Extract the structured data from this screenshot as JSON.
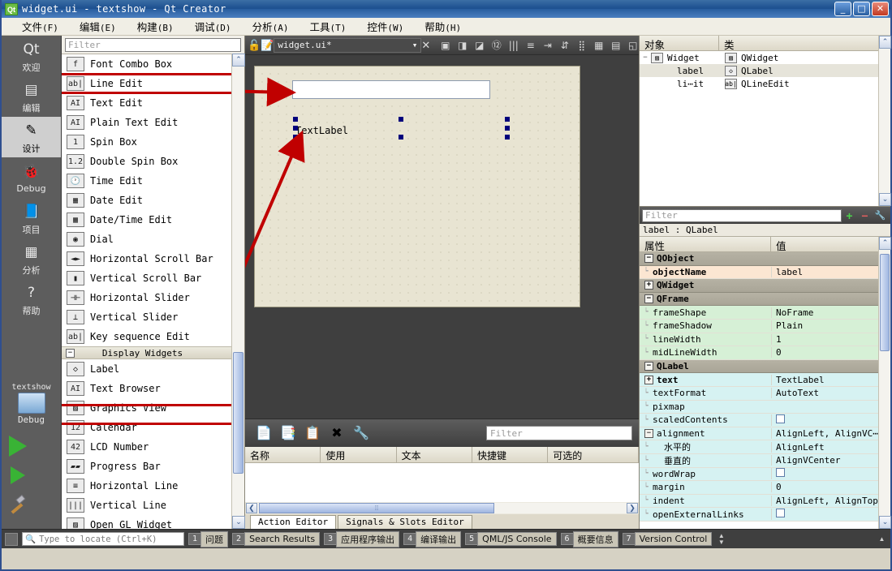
{
  "window": {
    "title": "widget.ui - textshow - Qt Creator",
    "app_icon": "qt-logo-icon",
    "minimize": "_",
    "maximize": "□",
    "close": "✕"
  },
  "menubar": [
    {
      "label": "文件",
      "mnemonic": "(F)"
    },
    {
      "label": "编辑",
      "mnemonic": "(E)"
    },
    {
      "label": "构建",
      "mnemonic": "(B)"
    },
    {
      "label": "调试",
      "mnemonic": "(D)"
    },
    {
      "label": "分析",
      "mnemonic": "(A)"
    },
    {
      "label": "工具",
      "mnemonic": "(T)"
    },
    {
      "label": "控件",
      "mnemonic": "(W)"
    },
    {
      "label": "帮助",
      "mnemonic": "(H)"
    }
  ],
  "modebar": {
    "items": [
      {
        "label": "欢迎",
        "icon": "qt-welcome-icon",
        "glyph": "Qt",
        "selected": false
      },
      {
        "label": "编辑",
        "icon": "edit-document-icon",
        "glyph": "▤",
        "selected": false
      },
      {
        "label": "设计",
        "icon": "design-brush-icon",
        "glyph": "✎",
        "selected": true
      },
      {
        "label": "Debug",
        "icon": "debug-bug-icon",
        "glyph": "🐞",
        "selected": false
      },
      {
        "label": "项目",
        "icon": "projects-folder-icon",
        "glyph": "📘",
        "selected": false
      },
      {
        "label": "分析",
        "icon": "analyze-monitor-icon",
        "glyph": "▦",
        "selected": false
      },
      {
        "label": "帮助",
        "icon": "help-question-icon",
        "glyph": "?",
        "selected": false
      }
    ],
    "kit": {
      "project": "textshow",
      "build_config": "Debug",
      "icon": "target-computer-icon",
      "arrow": "▸"
    },
    "run_button": "run-icon",
    "debug_button": "debug-run-icon",
    "build_button": "build-hammer-icon"
  },
  "widgetbox": {
    "filter_placeholder": "Filter",
    "items": [
      {
        "label": "Font Combo Box",
        "icon": "font-combo-box-icon",
        "glyph": "f"
      },
      {
        "label": "Line Edit",
        "icon": "line-edit-icon",
        "glyph": "ab|",
        "highlighted": true
      },
      {
        "label": "Text Edit",
        "icon": "text-edit-icon",
        "glyph": "AI"
      },
      {
        "label": "Plain Text Edit",
        "icon": "plain-text-edit-icon",
        "glyph": "AI"
      },
      {
        "label": "Spin Box",
        "icon": "spin-box-icon",
        "glyph": "1"
      },
      {
        "label": "Double Spin Box",
        "icon": "double-spin-box-icon",
        "glyph": "1.2"
      },
      {
        "label": "Time Edit",
        "icon": "time-edit-icon",
        "glyph": "🕐"
      },
      {
        "label": "Date Edit",
        "icon": "date-edit-icon",
        "glyph": "▦"
      },
      {
        "label": "Date/Time Edit",
        "icon": "date-time-edit-icon",
        "glyph": "▦"
      },
      {
        "label": "Dial",
        "icon": "dial-icon",
        "glyph": "◉"
      },
      {
        "label": "Horizontal Scroll Bar",
        "icon": "horizontal-scroll-bar-icon",
        "glyph": "◄►"
      },
      {
        "label": "Vertical Scroll Bar",
        "icon": "vertical-scroll-bar-icon",
        "glyph": "▮"
      },
      {
        "label": "Horizontal Slider",
        "icon": "horizontal-slider-icon",
        "glyph": "⊣⊢"
      },
      {
        "label": "Vertical Slider",
        "icon": "vertical-slider-icon",
        "glyph": "⊥"
      },
      {
        "label": "Key sequence Edit",
        "icon": "key-sequence-edit-icon",
        "glyph": "ab|"
      }
    ],
    "group": {
      "label": "Display Widgets",
      "expander": "−"
    },
    "display_items": [
      {
        "label": "Label",
        "icon": "label-tag-icon",
        "glyph": "◇",
        "highlighted": true
      },
      {
        "label": "Text Browser",
        "icon": "text-browser-icon",
        "glyph": "AI"
      },
      {
        "label": "Graphics View",
        "icon": "graphics-view-icon",
        "glyph": "▨"
      },
      {
        "label": "Calendar",
        "icon": "calendar-icon",
        "glyph": "12"
      },
      {
        "label": "LCD Number",
        "icon": "lcd-number-icon",
        "glyph": "42"
      },
      {
        "label": "Progress Bar",
        "icon": "progress-bar-icon",
        "glyph": "▰▰"
      },
      {
        "label": "Horizontal Line",
        "icon": "horizontal-line-icon",
        "glyph": "≡"
      },
      {
        "label": "Vertical Line",
        "icon": "vertical-line-icon",
        "glyph": "|||"
      },
      {
        "label": "Open GL Widget",
        "icon": "opengl-widget-icon",
        "glyph": "▨"
      }
    ],
    "scroll_up": "⌃",
    "scroll_down": "⌄"
  },
  "doctoolbar": {
    "lock_icon": "lock-icon",
    "file_icon": "ui-file-icon",
    "document": "widget.ui*",
    "dropdown": "▾",
    "close": "✕",
    "tools": [
      {
        "icon": "edit-widgets-icon",
        "glyph": "▣"
      },
      {
        "icon": "edit-signals-slots-icon",
        "glyph": "◨"
      },
      {
        "icon": "edit-buddies-icon",
        "glyph": "◪"
      },
      {
        "icon": "edit-tab-order-icon",
        "glyph": "⑫"
      },
      {
        "icon": "layout-horizontally-icon",
        "glyph": "|||"
      },
      {
        "icon": "layout-vertically-icon",
        "glyph": "≡"
      },
      {
        "icon": "layout-splitter-h-icon",
        "glyph": "⇥"
      },
      {
        "icon": "layout-splitter-v-icon",
        "glyph": "⇵"
      },
      {
        "icon": "layout-form-icon",
        "glyph": "⣿"
      },
      {
        "icon": "layout-grid-icon",
        "glyph": "▦"
      },
      {
        "icon": "break-layout-icon",
        "glyph": "▤"
      },
      {
        "icon": "adjust-size-icon",
        "glyph": "◱"
      }
    ]
  },
  "canvas": {
    "form_name": "Widget",
    "line_edit": {
      "name": "lineEdit",
      "text": ""
    },
    "label": {
      "name": "label",
      "text": "TextLabel",
      "selected": true
    },
    "annotations": [
      {
        "name": "arrow-to-line-edit",
        "from": "Line Edit",
        "to": "lineEdit on form"
      },
      {
        "name": "arrow-to-label",
        "from": "Label",
        "to": "TextLabel on form"
      }
    ]
  },
  "actioneditor": {
    "tools": [
      {
        "icon": "new-action-icon",
        "glyph": "📄"
      },
      {
        "icon": "copy-action-icon",
        "glyph": "📑"
      },
      {
        "icon": "paste-action-icon",
        "glyph": "📋"
      },
      {
        "icon": "delete-action-icon",
        "glyph": "✖"
      },
      {
        "icon": "configure-icon",
        "glyph": "🔧"
      }
    ],
    "filter_placeholder": "Filter",
    "columns": [
      "名称",
      "使用",
      "文本",
      "快捷键",
      "可选的"
    ],
    "rows": [],
    "tabs": [
      {
        "label": "Action Editor",
        "selected": true
      },
      {
        "label": "Signals & Slots Editor",
        "selected": false
      }
    ],
    "scroll_left": "❮",
    "scroll_right": "❯"
  },
  "objectinspector": {
    "columns": [
      "对象",
      "类"
    ],
    "rows": [
      {
        "indent": 0,
        "twisty": "−",
        "name": "Widget",
        "class": "QWidget",
        "icon": "qwidget-icon",
        "glyph": "▨",
        "selected": false
      },
      {
        "indent": 1,
        "twisty": "",
        "name": "label",
        "class": "QLabel",
        "icon": "qlabel-icon",
        "glyph": "◇",
        "selected": true
      },
      {
        "indent": 1,
        "twisty": "",
        "name": "li⋯it",
        "class": "QLineEdit",
        "icon": "qlineedit-icon",
        "glyph": "ab|",
        "selected": false
      }
    ],
    "scroll_up": "⌃",
    "scroll_down": "⌄"
  },
  "propertyeditor": {
    "filter_placeholder": "Filter",
    "add_button": "+",
    "remove_button": "−",
    "configure_button": "🔧",
    "subject": "label : QLabel",
    "columns": [
      "属性",
      "值"
    ],
    "rows": [
      {
        "kind": "group",
        "expander": "−",
        "name": "QObject",
        "value": "",
        "tint": "group"
      },
      {
        "kind": "prop",
        "name": "objectName",
        "value": "label",
        "tint": "peach",
        "bold": true
      },
      {
        "kind": "group",
        "expander": "+",
        "name": "QWidget",
        "value": "",
        "tint": "group"
      },
      {
        "kind": "group",
        "expander": "−",
        "name": "QFrame",
        "value": "",
        "tint": "group"
      },
      {
        "kind": "prop",
        "name": "frameShape",
        "value": "NoFrame",
        "tint": "green"
      },
      {
        "kind": "prop",
        "name": "frameShadow",
        "value": "Plain",
        "tint": "green"
      },
      {
        "kind": "prop",
        "name": "lineWidth",
        "value": "1",
        "tint": "green"
      },
      {
        "kind": "prop",
        "name": "midLineWidth",
        "value": "0",
        "tint": "green"
      },
      {
        "kind": "group",
        "expander": "−",
        "name": "QLabel",
        "value": "",
        "tint": "group"
      },
      {
        "kind": "prop",
        "expander": "+",
        "name": "text",
        "value": "TextLabel",
        "tint": "cyan",
        "bold": true
      },
      {
        "kind": "prop",
        "name": "textFormat",
        "value": "AutoText",
        "tint": "cyan"
      },
      {
        "kind": "prop",
        "name": "pixmap",
        "value": "",
        "tint": "cyan"
      },
      {
        "kind": "prop",
        "name": "scaledContents",
        "value": "",
        "tint": "cyan",
        "checkbox": true
      },
      {
        "kind": "prop",
        "expander": "−",
        "name": "alignment",
        "value": "AlignLeft, AlignVC⋯",
        "tint": "cyan"
      },
      {
        "kind": "sub",
        "name": "水平的",
        "value": "AlignLeft",
        "tint": "cyan"
      },
      {
        "kind": "sub",
        "name": "垂直的",
        "value": "AlignVCenter",
        "tint": "cyan"
      },
      {
        "kind": "prop",
        "name": "wordWrap",
        "value": "",
        "tint": "cyan",
        "checkbox": true
      },
      {
        "kind": "prop",
        "name": "margin",
        "value": "0",
        "tint": "cyan"
      },
      {
        "kind": "prop",
        "name": "indent",
        "value": "AlignLeft, AlignTop",
        "tint": "cyan"
      },
      {
        "kind": "prop",
        "name": "openExternalLinks",
        "value": "",
        "tint": "cyan",
        "checkbox": true
      }
    ]
  },
  "statusbar": {
    "toggle_sidebar": "sidebar-toggle-icon",
    "locator_placeholder": "Type to locate (Ctrl+K)",
    "search_icon": "search-icon",
    "panes": [
      {
        "num": "1",
        "label": "问题"
      },
      {
        "num": "2",
        "label": "Search Results"
      },
      {
        "num": "3",
        "label": "应用程序输出"
      },
      {
        "num": "4",
        "label": "编译输出"
      },
      {
        "num": "5",
        "label": "QML/JS Console"
      },
      {
        "num": "6",
        "label": "概要信息"
      },
      {
        "num": "7",
        "label": "Version Control"
      }
    ]
  },
  "colors": {
    "titlebar_blue": "#1c4f8f",
    "annotation_red": "#c00000",
    "form_background": "#e8e4d2",
    "selection_handle": "#00007c",
    "prop_peach": "#fbe6d2",
    "prop_green": "#d6f0d6",
    "prop_cyan": "#d6f2f2"
  }
}
